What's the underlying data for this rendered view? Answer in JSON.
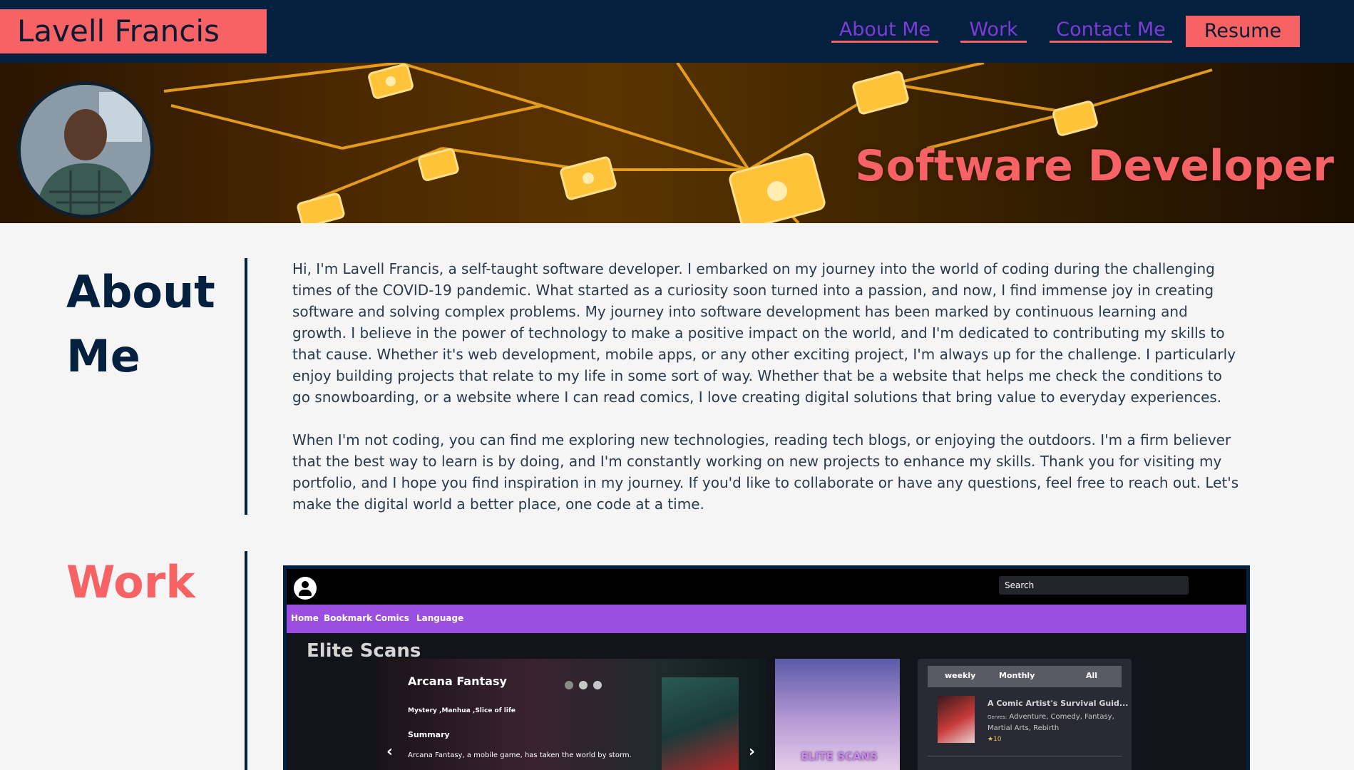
{
  "header": {
    "brand": "Lavell Francis",
    "nav": [
      "About Me",
      "Work",
      "Contact Me"
    ],
    "resume_label": "Resume"
  },
  "hero": {
    "title": "Software Developer"
  },
  "about": {
    "heading_line1": "About",
    "heading_line2": "Me",
    "paragraph1": "Hi, I'm Lavell Francis, a self-taught software developer. I embarked on my journey into the world of coding during the challenging times of the COVID-19 pandemic. What started as a curiosity soon turned into a passion, and now, I find immense joy in creating software and solving complex problems. My journey into software development has been marked by continuous learning and growth. I believe in the power of technology to make a positive impact on the world, and I'm dedicated to contributing my skills to that cause. Whether it's web development, mobile apps, or any other exciting project, I'm always up for the challenge. I particularly enjoy building projects that relate to my life in some sort of way. Whether that be a website that helps me check the conditions to go snowboarding, or a website where I can read comics, I love creating digital solutions that bring value to everyday experiences.",
    "paragraph2": "When I'm not coding, you can find me exploring new technologies, reading tech blogs, or enjoying the outdoors. I'm a firm believer that the best way to learn is by doing, and I'm constantly working on new projects to enhance my skills. Thank you for visiting my portfolio, and I hope you find inspiration in my journey. If you'd like to collaborate or have any questions, feel free to reach out. Let's make the digital world a better place, one code at a time."
  },
  "work": {
    "heading": "Work",
    "project": {
      "search_placeholder": "Search",
      "nav": [
        "Home",
        "Bookmark",
        "Comics",
        "Language"
      ],
      "site_title": "Elite Scans",
      "carousel": {
        "title": "Arcana Fantasy",
        "genres": "Mystery ,Manhua ,Slice of life",
        "summary_heading": "Summary",
        "summary": "Arcana Fantasy, a mobile game, has taken the world by storm.",
        "prev": "‹",
        "next": "›"
      },
      "cover_text": "ELITE SCANS",
      "ranking": {
        "tabs": [
          "weekly",
          "Monthly",
          "All"
        ],
        "item_title": "A Comic Artist's Survival Guid...",
        "genres_label": "Genres:",
        "genres": "Adventure, Comedy, Fantasy, Martial Arts, Rebirth",
        "score": "★10"
      }
    }
  },
  "colors": {
    "navy": "#04203f",
    "coral": "#f76264",
    "purple_link": "#7e3bd6",
    "shot_nav_purple": "#9a4fe0"
  }
}
